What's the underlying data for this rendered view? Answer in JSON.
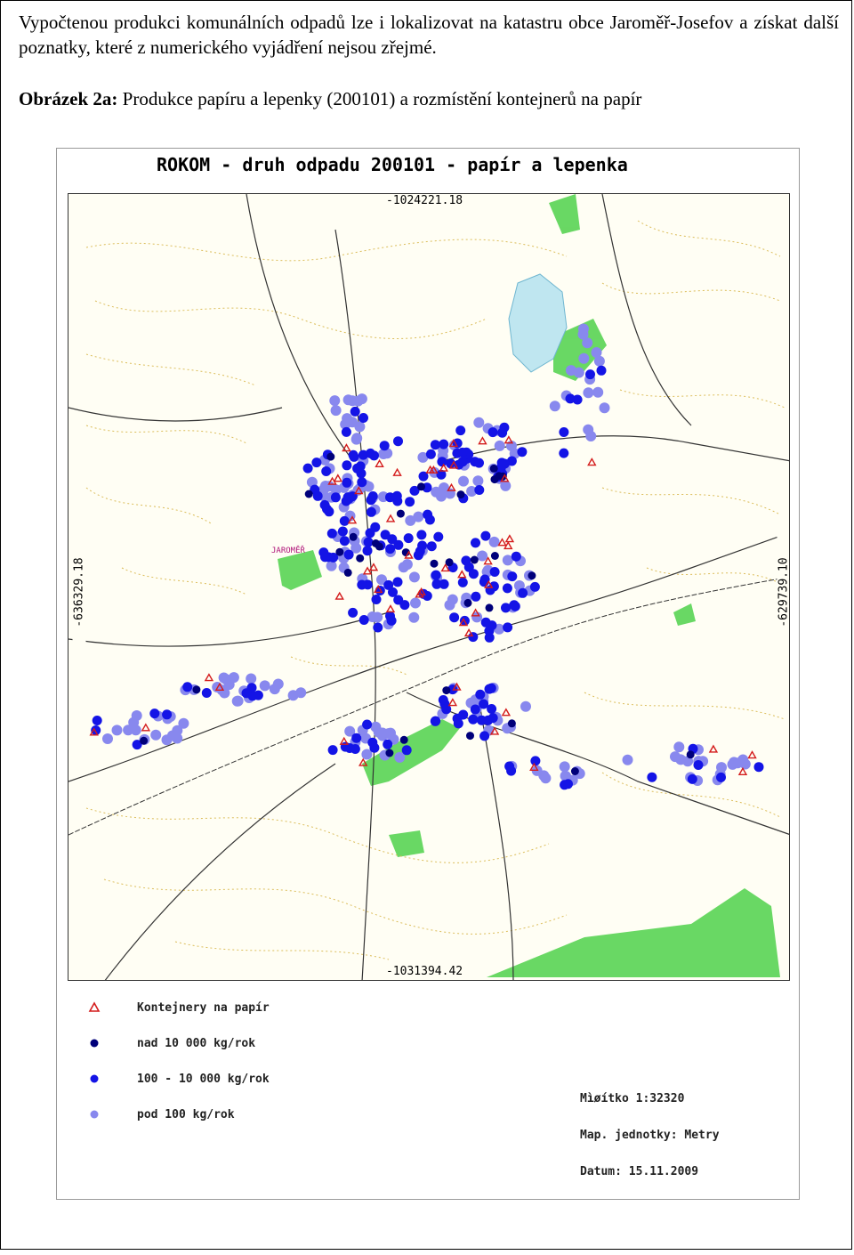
{
  "intro_text": "Vypočtenou produkci komunálních odpadů lze i lokalizovat na katastru obce Jaroměř-Josefov a získat další poznatky, které z numerického vyjádření nejsou zřejmé.",
  "caption": {
    "label": "Obrázek 2a:",
    "text": " Produkce papíru a lepenky (200101) a rozmístění kontejnerů na papír"
  },
  "map": {
    "title": "ROKOM - druh odpadu 200101 - papír a lepenka",
    "coord_top": "-1024221.18",
    "coord_bottom": "-1031394.42",
    "coord_left": "-636329.18",
    "coord_right": "-629739.10",
    "place_label": "JAROMĚŘ",
    "colors": {
      "container_red": "#d41c1c",
      "dark_navy": "#00007a",
      "blue": "#1414e6",
      "light_blue": "#8888ee",
      "green": "#4fd14a",
      "water": "#bfe6f0",
      "contour": "#d8b64a",
      "road": "#333333"
    }
  },
  "legend": [
    {
      "symbol": "red-triangle",
      "label": "Kontejnery na papír"
    },
    {
      "symbol": "dark-navy-dot",
      "label": "nad 10 000 kg/rok"
    },
    {
      "symbol": "blue-dot",
      "label": "100 - 10 000 kg/rok"
    },
    {
      "symbol": "light-blue-dot",
      "label": "pod 100 kg/rok"
    }
  ],
  "meta": {
    "scale": "Mìøítko 1:32320",
    "units": "Map. jednotky: Metry",
    "date": "Datum: 15.11.2009"
  }
}
